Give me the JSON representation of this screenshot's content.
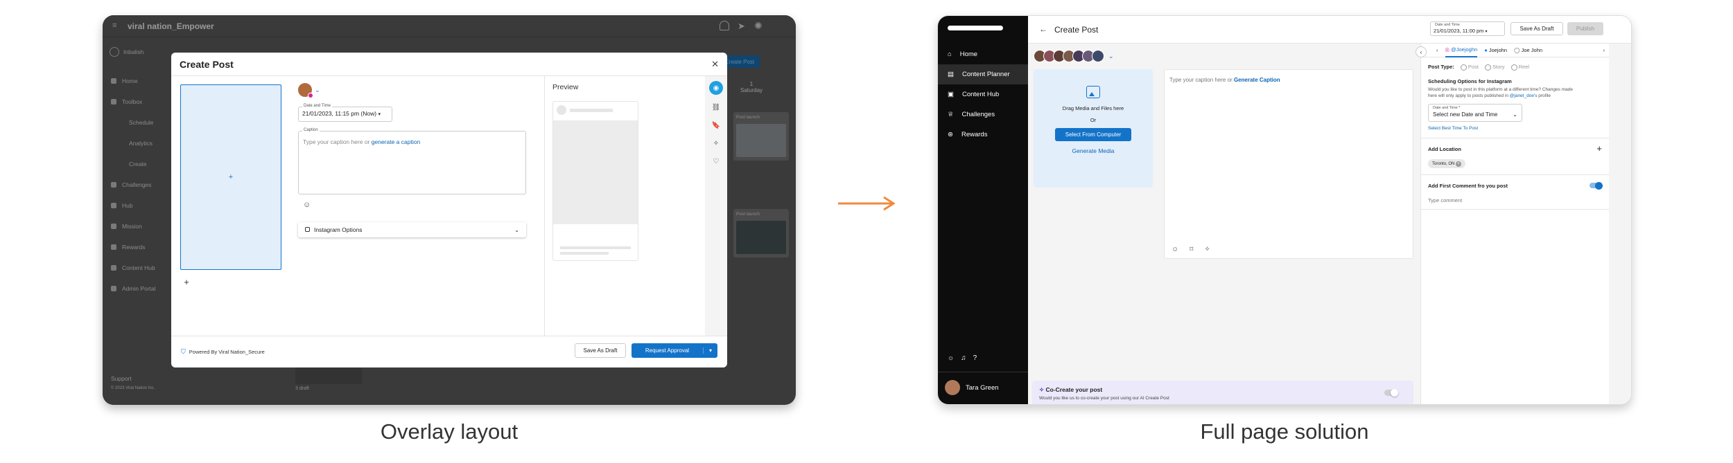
{
  "captions": {
    "left": "Overlay layout",
    "right": "Full page solution"
  },
  "left": {
    "brand": "viral nation_Empower",
    "user": "Inbalish",
    "sidebar": [
      "Home",
      "Toolbox",
      "Schedule",
      "Analytics",
      "Create",
      "Challenges",
      "Hub",
      "Mission",
      "Rewards",
      "Content Hub",
      "Admin Portal"
    ],
    "support": "Support",
    "copyright": "© 2023 Viral Nation Inc.",
    "bg_button": "Create Post",
    "bg_cal_day": "1",
    "bg_cal_weekday": "Saturday",
    "bg_card_label": "Post launch",
    "bg_bottom_label": "3 draft",
    "modal": {
      "title": "Create Post",
      "date_label": "Date and Time",
      "date_value": "21/01/2023, 11:15 pm (Now)",
      "caption_label": "Caption",
      "caption_placeholder": "Type your caption here or ",
      "caption_link": "generate a caption",
      "instagram_options": "Instagram Options",
      "preview": "Preview",
      "powered": "Powered By Viral Nation_Secure",
      "save_draft": "Save As Draft",
      "request_approval": "Request Approval"
    }
  },
  "right": {
    "nav": [
      "Home",
      "Content Planner",
      "Content Hub",
      "Challenges",
      "Rewards"
    ],
    "user": "Tara Green",
    "title": "Create Post",
    "date_label": "Date and Time",
    "date_value": "21/01/2023, 11:00 pm",
    "save_draft": "Save As Draft",
    "publish": "Publish",
    "media": {
      "drag": "Drag Media and Files here",
      "or": "Or",
      "select": "Select From Computer",
      "generate": "Generate Media"
    },
    "caption": {
      "placeholder": "Type your caption here or ",
      "link": "Generate Caption"
    },
    "cocreate": {
      "title": "Co-Create your post",
      "desc": "Would you like us to co-create your post using our AI Create Post"
    },
    "tabs": [
      "@Joejoghn",
      "Joejohn",
      "Joe John"
    ],
    "post_type": {
      "label": "Post Type:",
      "options": [
        "Post",
        "Story",
        "Reel"
      ]
    },
    "scheduling": {
      "title": "Scheduling Options for Instagram",
      "desc": "Would you like to post in this platform at a different time? Changes made here will only apply to posts published in ",
      "handle": "@janet_doe's",
      "suffix": " profile",
      "field_label": "Date and Time *",
      "field_value": "Select new Date and Time",
      "best_time": "Select Best Time To Post"
    },
    "location": {
      "title": "Add Location",
      "chip": "Toronto, ON"
    },
    "first_comment": {
      "title": "Add First Comment fro you post",
      "placeholder": "Type comment"
    }
  },
  "colors": {
    "arrow": "#f08a3c",
    "blue": "#1373c9",
    "lavender": "#ece9fb",
    "panel_blue": "#e3eefb"
  }
}
